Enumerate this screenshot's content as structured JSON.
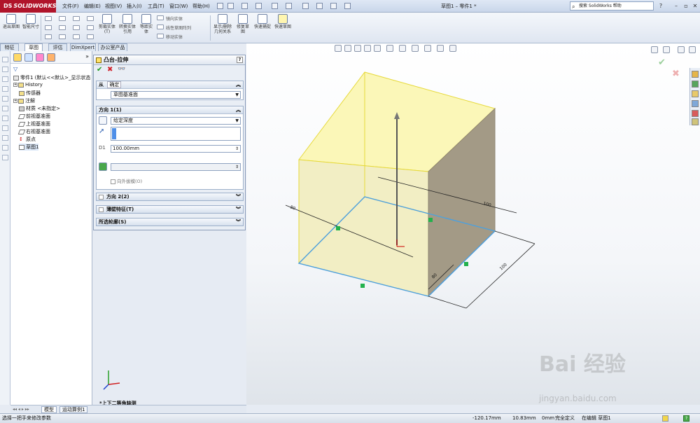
{
  "app": {
    "logo_prefix": "DS",
    "logo_text": "SOLIDWORKS",
    "doc_title": "草图1 – 零件1 *"
  },
  "menu": [
    "文件(F)",
    "编辑(E)",
    "视图(V)",
    "插入(I)",
    "工具(T)",
    "窗口(W)",
    "帮助(H)"
  ],
  "search": {
    "placeholder": "搜索 SolidWorks 帮助"
  },
  "cmd": {
    "exit_sketch": "退出草图",
    "smart_dim": "智能尺寸",
    "trim": "剪裁实体(T)",
    "convert": "转换实体引用",
    "offset": "等距实体",
    "mirror": "镜向实体",
    "linear_pattern": "线性草图阵列",
    "move": "移动实体",
    "display_delete": "显示/删除几何关系",
    "repair": "修复草图",
    "quick_snaps": "快速捕捉",
    "rapid_sketch": "快速草图"
  },
  "tabs": [
    "特征",
    "草图",
    "评估",
    "DimXpert",
    "办公室产品"
  ],
  "tree": {
    "root": "零件1 (默认<<默认>_显示状态",
    "items": [
      "History",
      "传感器",
      "注解",
      "材质 <未指定>",
      "前视基准面",
      "上视基准面",
      "右视基准面",
      "原点",
      "草图1"
    ]
  },
  "pm": {
    "title": "凸台-拉伸",
    "from_group": "从",
    "from_tab": "确定",
    "from_value": "草图基准面",
    "dir1_group": "方向 1(1)",
    "end_condition": "给定深度",
    "depth": "100.00mm",
    "draft_outward": "向外拔模(O)",
    "dir2": "方向 2(2)",
    "thin": "薄壁特征(T)",
    "contours": "所选轮廓(S)"
  },
  "view_label": "*上下二等角轴测",
  "bottom_tabs": [
    "模型",
    "运动算例1"
  ],
  "status": {
    "hint": "选择一把手来修改参数",
    "x": "-120.17mm",
    "y": "10.83mm",
    "z": "0mm",
    "defined": "完全定义",
    "editing": "在编辑 草图1"
  },
  "dimensions": {
    "width": "100",
    "depth": "80",
    "height": "80",
    "length": "100"
  },
  "watermark": {
    "main": "Bai 经验",
    "sub": "jingyan.baidu.com"
  },
  "colors": {
    "accent": "#b0142a",
    "preview_fill": "#f7f3b3",
    "edge": "#e6d93a"
  }
}
